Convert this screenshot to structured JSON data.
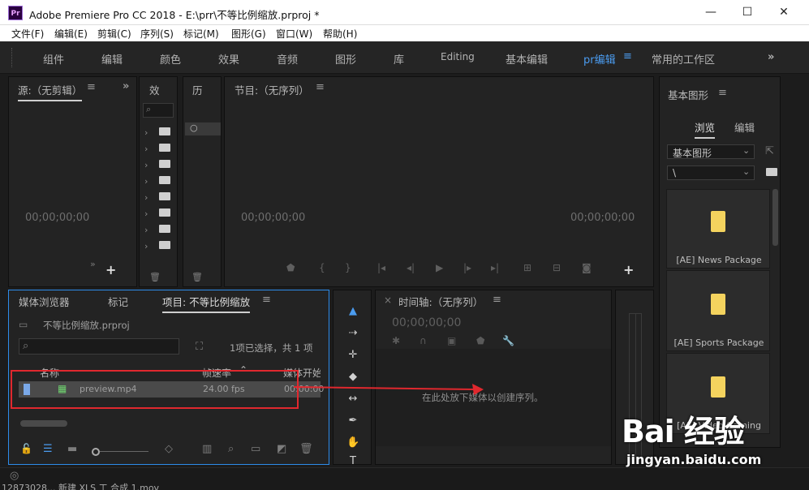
{
  "window": {
    "app_icon": "Pr",
    "title": "Adobe Premiere Pro CC 2018 - E:\\prr\\不等比例缩放.prproj *",
    "minimize": "—",
    "maximize": "☐",
    "close": "✕"
  },
  "menu": [
    "文件(F)",
    "编辑(E)",
    "剪辑(C)",
    "序列(S)",
    "标记(M)",
    "图形(G)",
    "窗口(W)",
    "帮助(H)"
  ],
  "workspaces": [
    "组件",
    "编辑",
    "颜色",
    "效果",
    "音频",
    "图形",
    "库",
    "Editing",
    "基本编辑",
    "pr编辑",
    "常用的工作区"
  ],
  "workspace_active": "pr编辑",
  "source_panel": {
    "title": "源:（无剪辑）",
    "timecode": "00;00;00;00"
  },
  "effects_panel": {
    "title": "效"
  },
  "history_panel": {
    "title": "历"
  },
  "program_panel": {
    "title": "节目:（无序列）",
    "timecode_left": "00;00;00;00",
    "timecode_right": "00;00;00;00"
  },
  "project_panel": {
    "tabs": [
      "媒体浏览器",
      "标记",
      "项目: 不等比例缩放"
    ],
    "file": "不等比例缩放.prproj",
    "selection_info": "1项已选择，共 1 项",
    "columns": [
      "名称",
      "帧速率",
      "媒体开始"
    ],
    "rows": [
      {
        "name": "preview.mp4",
        "fps": "24.00 fps",
        "start": "00:00:00"
      }
    ]
  },
  "timeline_panel": {
    "title": "时间轴:（无序列）",
    "timecode": "00;00;00;00",
    "drop_hint": "在此处放下媒体以创建序列。"
  },
  "graphics_panel": {
    "title": "基本图形",
    "tabs": [
      "浏览",
      "编辑"
    ],
    "dropdown1": "基本图形",
    "dropdown2": "\\",
    "items": [
      "[AE] News Package",
      "[AE] Sports Package",
      "[AE] Video Gaming"
    ]
  },
  "status_bar": {
    "text": "12873028... 新建 XLS 工 合成 1.mov"
  },
  "watermark": {
    "brand": "Bai 经验",
    "url": "jingyan.baidu.com"
  },
  "colors": {
    "accent": "#4b9cf0",
    "annotation": "#e0282e",
    "panel_bg": "#232323"
  }
}
